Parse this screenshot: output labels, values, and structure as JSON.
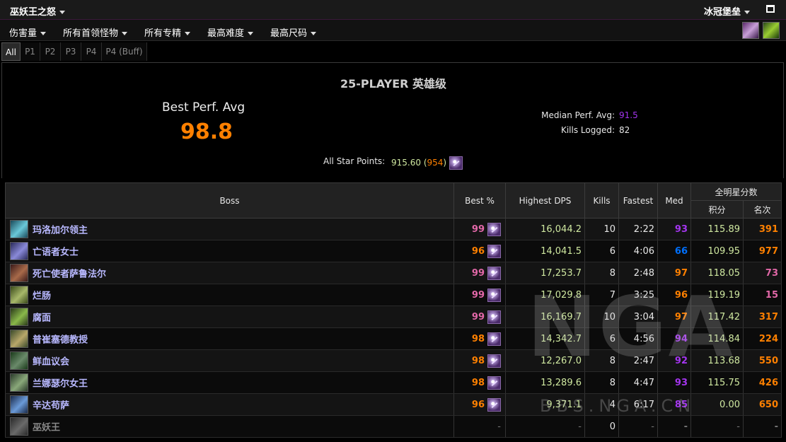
{
  "titlebar": {
    "zone": "巫妖王之怒",
    "raid": "冰冠堡垒"
  },
  "filters": [
    "伤害量",
    "所有首领怪物",
    "所有专精",
    "最高难度",
    "最高尺码"
  ],
  "tabs": [
    "All",
    "P1",
    "P2",
    "P3",
    "P4",
    "P4 (Buff)"
  ],
  "active_tab": "All",
  "summary": {
    "heading": "25-PLAYER 英雄级",
    "best_perf_label": "Best Perf. Avg",
    "best_perf_value": "98.8",
    "median_label": "Median Perf. Avg:",
    "median_value": "91.5",
    "kills_label": "Kills Logged:",
    "kills_value": "82",
    "stars_label": "All Star Points:",
    "stars_points": "915.60",
    "stars_rank": "954"
  },
  "table": {
    "headers": {
      "boss": "Boss",
      "best": "Best %",
      "dps": "Highest DPS",
      "kills": "Kills",
      "fastest": "Fastest",
      "med": "Med",
      "allstars": "全明星分数",
      "points": "积分",
      "rank": "名次"
    },
    "rows": [
      {
        "boss": "玛洛加尔领主",
        "best": "99",
        "dps": "16,044.2",
        "kills": "10",
        "fastest": "2:22",
        "med": "93",
        "points": "115.89",
        "rank": "391"
      },
      {
        "boss": "亡语者女士",
        "best": "96",
        "dps": "14,041.5",
        "kills": "6",
        "fastest": "4:06",
        "med": "66",
        "points": "109.95",
        "rank": "977"
      },
      {
        "boss": "死亡使者萨鲁法尔",
        "best": "99",
        "dps": "17,253.7",
        "kills": "8",
        "fastest": "2:48",
        "med": "97",
        "points": "118.05",
        "rank": "73"
      },
      {
        "boss": "烂肠",
        "best": "99",
        "dps": "17,029.8",
        "kills": "7",
        "fastest": "3:25",
        "med": "96",
        "points": "119.19",
        "rank": "15"
      },
      {
        "boss": "腐面",
        "best": "99",
        "dps": "16,169.7",
        "kills": "10",
        "fastest": "3:04",
        "med": "97",
        "points": "117.42",
        "rank": "317"
      },
      {
        "boss": "普崔塞德教授",
        "best": "98",
        "dps": "14,342.7",
        "kills": "6",
        "fastest": "4:56",
        "med": "94",
        "points": "114.84",
        "rank": "224"
      },
      {
        "boss": "鲜血议会",
        "best": "98",
        "dps": "12,267.0",
        "kills": "8",
        "fastest": "2:47",
        "med": "92",
        "points": "113.68",
        "rank": "550"
      },
      {
        "boss": "兰娜瑟尔女王",
        "best": "98",
        "dps": "13,289.6",
        "kills": "8",
        "fastest": "4:47",
        "med": "93",
        "points": "115.75",
        "rank": "426"
      },
      {
        "boss": "辛达苟萨",
        "best": "96",
        "dps": "9,371.1",
        "kills": "4",
        "fastest": "6:17",
        "med": "85",
        "points": "0.00",
        "rank": "650"
      },
      {
        "boss": "巫妖王",
        "best": "-",
        "dps": "-",
        "kills": "0",
        "fastest": "-",
        "med": "-",
        "points": "-",
        "rank": "-"
      }
    ]
  },
  "colors": {
    "pink": "#e268a8",
    "orange": "#ff8000",
    "purple": "#a335ee",
    "blue": "#0070ff",
    "points": "#cfe8a0",
    "rank_orange": "#ff8000",
    "rank_pink": "#e268a8"
  },
  "watermark": {
    "logo": "NGA",
    "url": "BBS.NGA.CN"
  }
}
